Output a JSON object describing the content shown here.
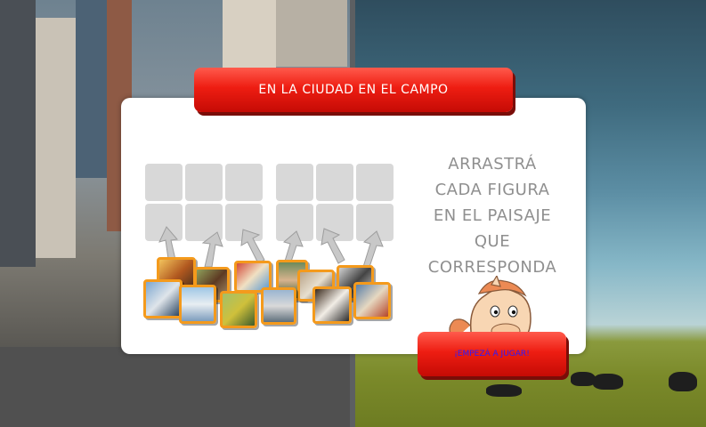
{
  "game": {
    "title": "EN LA CIUDAD EN EL CAMPO",
    "instructions": [
      "ARRASTRÁ",
      "CADA FIGURA",
      "EN EL PAISAJE",
      "QUE CORRESPONDA"
    ],
    "start_button_label": "¡EMPEZÁ A JUGAR!"
  },
  "colors": {
    "banner_red": "#ee1d12",
    "slot_gray": "#d8d8d8",
    "thumb_border": "#f49a1c",
    "instruction_text": "#8f8f8f",
    "button_text": "#2b1bff"
  },
  "icons": [
    "up-arrow-icon",
    "horse-mascot-icon"
  ]
}
